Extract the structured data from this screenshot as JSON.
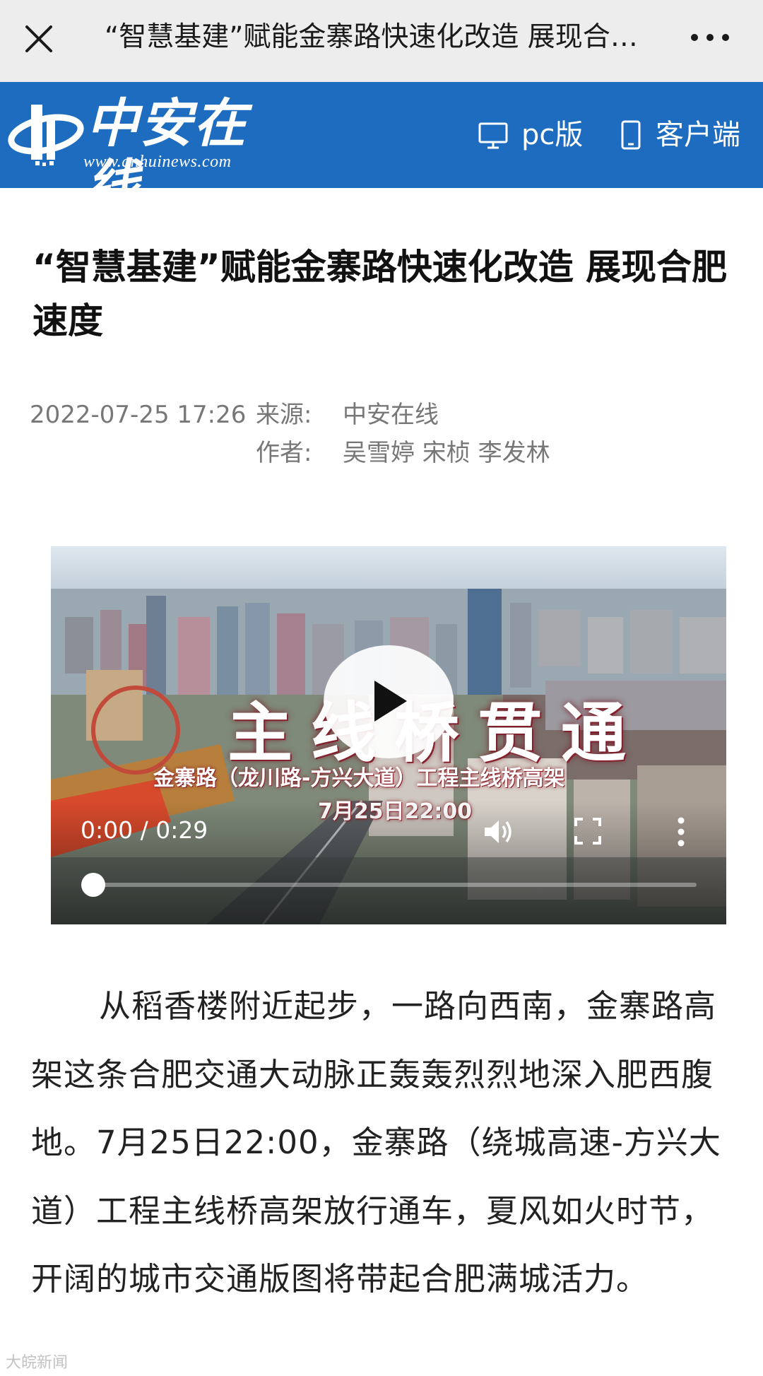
{
  "topbar": {
    "title": "“智慧基建”赋能金寨路快速化改造 展现合肥速度",
    "close_icon": "close-icon",
    "more_icon": "more-horizontal-icon"
  },
  "site_header": {
    "logo_text": "中安在线",
    "logo_url": "www.anhuinews.com",
    "pc_label": "pc版",
    "app_label": "客户端",
    "brand_color": "#1e6cc0"
  },
  "article": {
    "headline": "“智慧基建”赋能金寨路快速化改造 展现合肥速度",
    "date": "2022-07-25 17:26",
    "source_label": "来源:",
    "source_value": "中安在线",
    "author_label": "作者:",
    "author_value": "吴雪婷 宋桢 李发林",
    "body": "从稻香楼附近起步，一路向西南，金寨路高架这条合肥交通大动脉正轰轰烈烈地深入肥西腹地。7月25日22:00，金寨路（绕城高速-方兴大道）工程主线桥高架放行通车，夏风如火时节，开阔的城市交通版图将带起合肥满城活力。"
  },
  "video": {
    "overlay_title": "主线桥贯通",
    "overlay_subtitle": "金寨路（龙川路-方兴大道）工程主线桥高架",
    "overlay_time": "7月25日22:00",
    "time_display": "0:00 / 0:29",
    "progress": 0
  },
  "watermark": "大皖新闻"
}
